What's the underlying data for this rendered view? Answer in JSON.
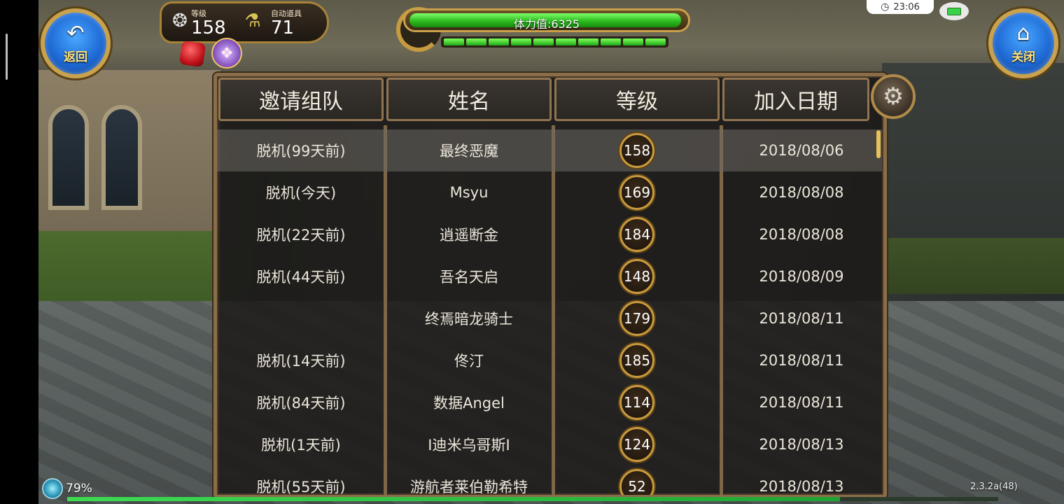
{
  "topbar": {
    "back_label": "返回",
    "close_label": "关闭",
    "level_caption": "等级",
    "level_value": "158",
    "auto_items_caption": "自动道具",
    "auto_items_value": "71",
    "stamina_label": "体力值:6325",
    "stamina_fraction": 0.99,
    "stamina_segments": 10,
    "clock": "23:06"
  },
  "table": {
    "headers": [
      "邀请组队",
      "姓名",
      "等级",
      "加入日期"
    ],
    "rows": [
      {
        "status": "脱机(99天前)",
        "name": "最终恶魔",
        "level": "158",
        "date": "2018/08/06"
      },
      {
        "status": "脱机(今天)",
        "name": "Msyu",
        "level": "169",
        "date": "2018/08/08"
      },
      {
        "status": "脱机(22天前)",
        "name": "逍遥断金",
        "level": "184",
        "date": "2018/08/08"
      },
      {
        "status": "脱机(44天前)",
        "name": "吾名天启",
        "level": "148",
        "date": "2018/08/09"
      },
      {
        "status": "",
        "name": "终焉暗龙骑士",
        "level": "179",
        "date": "2018/08/11"
      },
      {
        "status": "脱机(14天前)",
        "name": "佟汀",
        "level": "185",
        "date": "2018/08/11"
      },
      {
        "status": "脱机(84天前)",
        "name": "数据Angel",
        "level": "114",
        "date": "2018/08/11"
      },
      {
        "status": "脱机(1天前)",
        "name": "I迪米乌哥斯I",
        "level": "124",
        "date": "2018/08/13"
      },
      {
        "status": "脱机(55天前)",
        "name": "游航者莱伯勒希特",
        "level": "52",
        "date": "2018/08/13"
      }
    ]
  },
  "bottom": {
    "percent": "79%",
    "version": "2.3.2a(48)",
    "exp_fraction": 0.83
  },
  "icons": {
    "back": "back-arrow-icon",
    "close": "home-icon",
    "settings": "gear-icon",
    "level": "level-icon",
    "auto_items": "potion-icon",
    "gift": "gift-icon",
    "gem": "gem-icon",
    "clock": "clock-icon",
    "battery": "battery-icon"
  },
  "colors": {
    "gold_frame": "#b68d3c",
    "stamina_green": "#2dbd1e",
    "button_blue": "#1e6ad6",
    "label_yellow": "#ffe07a"
  }
}
